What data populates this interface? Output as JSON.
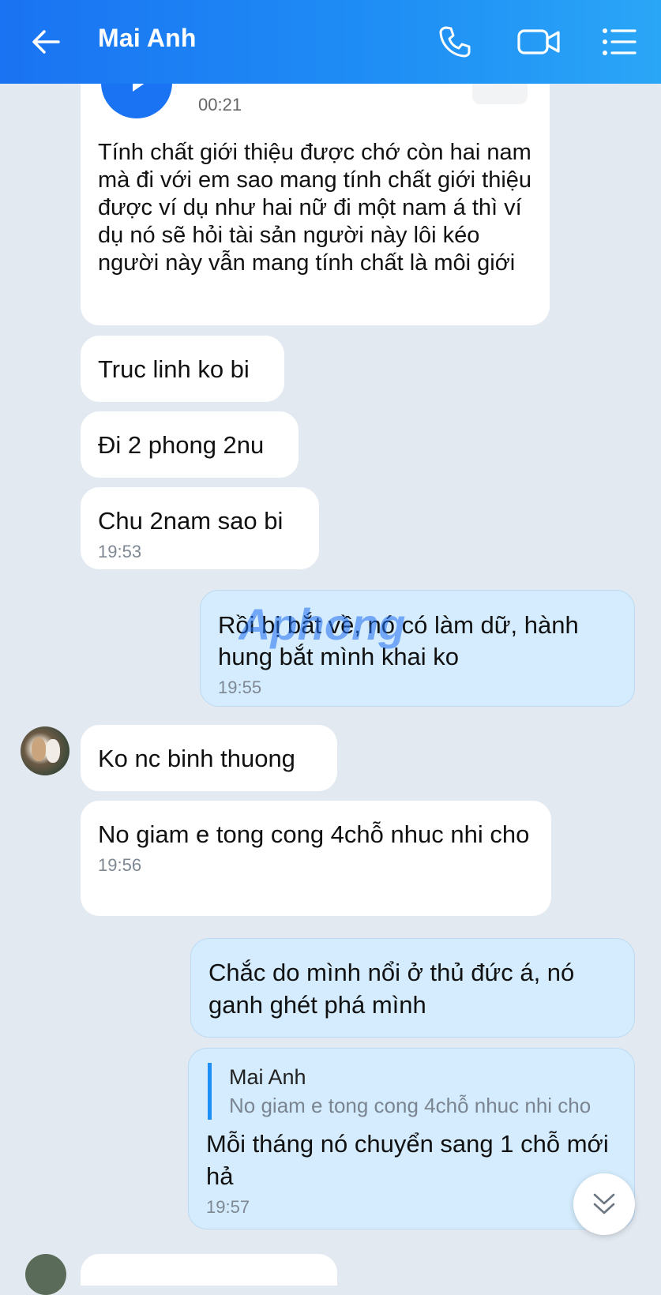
{
  "header": {
    "title": "Mai Anh"
  },
  "icons": {
    "back": "arrow-left-icon",
    "call": "phone-icon",
    "video": "video-camera-icon",
    "menu": "list-menu-icon",
    "scroll_down": "double-chevron-down-icon"
  },
  "colors": {
    "header_start": "#1a73f2",
    "header_end": "#2aa6f6",
    "outgoing_bubble": "#d4ecfd",
    "incoming_bubble": "#ffffff",
    "background": "#e2e9f1"
  },
  "messages": {
    "voice": {
      "duration": "00:21",
      "transcript": "Tính chất giới thiệu được chớ còn hai nam mà đi với em sao mang tính chất giới thiệu được ví dụ như hai nữ đi một nam á thì ví dụ nó sẽ hỏi tài sản người này lôi kéo người này vẫn mang tính chất là môi giới"
    },
    "m1": {
      "text": "Truc linh ko bi"
    },
    "m2": {
      "text": "Đi 2 phong 2nu"
    },
    "m3": {
      "text": "Chu 2nam sao bi",
      "time": "19:53"
    },
    "m4": {
      "text": "Rồi bị bắt về, nó có làm dữ, hành hung bắt mình khai ko",
      "time": "19:55"
    },
    "m5": {
      "text": "Ko nc binh thuong"
    },
    "m6": {
      "text": "No giam e tong cong 4chỗ nhuc nhi cho",
      "time": "19:56"
    },
    "m7": {
      "text": "Chắc do mình nổi ở thủ đức á, nó ganh ghét phá mình"
    },
    "m8": {
      "quote_name": "Mai Anh",
      "quote_text": "No giam e tong cong 4chỗ nhuc nhi cho",
      "text": "Mỗi tháng nó chuyển sang 1 chỗ mới hả",
      "time": "19:57"
    }
  },
  "watermark": "Aphong"
}
